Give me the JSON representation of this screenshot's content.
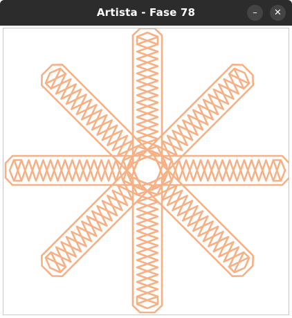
{
  "window": {
    "title": "Artista - Fase 78",
    "minimize_glyph": "–",
    "close_glyph": "✕"
  },
  "drawing": {
    "stroke_color": "#f7b084",
    "background": "#ffffff",
    "arms": [
      {
        "name": "arm-up",
        "angle": -90
      },
      {
        "name": "arm-up-right",
        "angle": -45
      },
      {
        "name": "arm-right",
        "angle": 0
      },
      {
        "name": "arm-down-right",
        "angle": 45
      },
      {
        "name": "arm-down",
        "angle": 90
      },
      {
        "name": "arm-down-left",
        "angle": 135
      },
      {
        "name": "arm-left",
        "angle": 180
      },
      {
        "name": "arm-up-left",
        "angle": 225
      }
    ]
  }
}
